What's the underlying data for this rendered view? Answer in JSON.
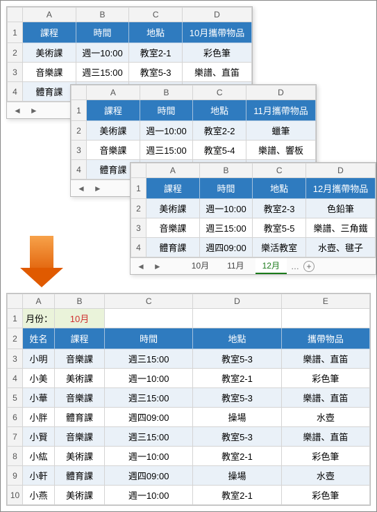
{
  "cols": [
    "A",
    "B",
    "C",
    "D"
  ],
  "headers": {
    "course": "課程",
    "time": "時間",
    "place": "地點"
  },
  "sheets": [
    {
      "vary_header": "10月攜帶物品",
      "rows": [
        {
          "course": "美術課",
          "time": "週一10:00",
          "place": "教室2-1",
          "item": "彩色筆"
        },
        {
          "course": "音樂課",
          "time": "週三15:00",
          "place": "教室5-3",
          "item": "樂譜、直笛"
        },
        {
          "course": "體育課",
          "time": "",
          "place": "",
          "item": ""
        }
      ]
    },
    {
      "vary_header": "11月攜帶物品",
      "rows": [
        {
          "course": "美術課",
          "time": "週一10:00",
          "place": "教室2-2",
          "item": "蠟筆"
        },
        {
          "course": "音樂課",
          "time": "週三15:00",
          "place": "教室5-4",
          "item": "樂譜、響板"
        },
        {
          "course": "體育課",
          "time": "",
          "place": "",
          "item": ""
        }
      ]
    },
    {
      "vary_header": "12月攜帶物品",
      "rows": [
        {
          "course": "美術課",
          "time": "週一10:00",
          "place": "教室2-3",
          "item": "色鉛筆"
        },
        {
          "course": "音樂課",
          "time": "週三15:00",
          "place": "教室5-5",
          "item": "樂譜、三角鐵"
        },
        {
          "course": "體育課",
          "time": "週四09:00",
          "place": "樂活教室",
          "item": "水壺、毽子"
        }
      ]
    }
  ],
  "tabs": {
    "left": "◄",
    "right": "►",
    "items": [
      "10月",
      "11月",
      "12月"
    ],
    "active": 2,
    "dots": "…",
    "plus": "+"
  },
  "result": {
    "cols": [
      "A",
      "B",
      "C",
      "D",
      "E"
    ],
    "month_label": "月份：",
    "month_value": "10月",
    "headers": {
      "name": "姓名",
      "course": "課程",
      "time": "時間",
      "place": "地點",
      "item": "攜帶物品"
    },
    "rows": [
      {
        "name": "小明",
        "course": "音樂課",
        "time": "週三15:00",
        "place": "教室5-3",
        "item": "樂譜、直笛"
      },
      {
        "name": "小美",
        "course": "美術課",
        "time": "週一10:00",
        "place": "教室2-1",
        "item": "彩色筆"
      },
      {
        "name": "小華",
        "course": "音樂課",
        "time": "週三15:00",
        "place": "教室5-3",
        "item": "樂譜、直笛"
      },
      {
        "name": "小胖",
        "course": "體育課",
        "time": "週四09:00",
        "place": "操場",
        "item": "水壺"
      },
      {
        "name": "小賢",
        "course": "音樂課",
        "time": "週三15:00",
        "place": "教室5-3",
        "item": "樂譜、直笛"
      },
      {
        "name": "小紘",
        "course": "美術課",
        "time": "週一10:00",
        "place": "教室2-1",
        "item": "彩色筆"
      },
      {
        "name": "小軒",
        "course": "體育課",
        "time": "週四09:00",
        "place": "操場",
        "item": "水壺"
      },
      {
        "name": "小燕",
        "course": "美術課",
        "time": "週一10:00",
        "place": "教室2-1",
        "item": "彩色筆"
      }
    ]
  }
}
